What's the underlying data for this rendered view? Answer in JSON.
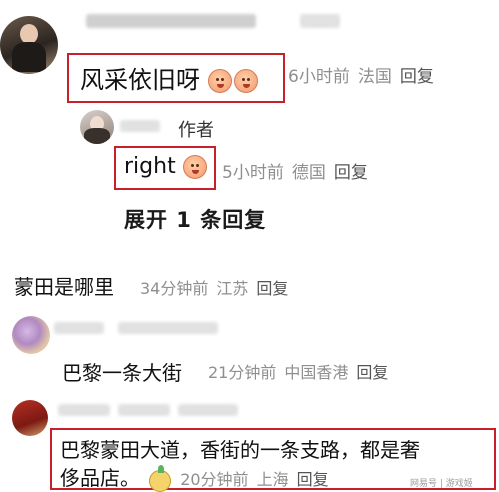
{
  "comments": [
    {
      "text": "风采依旧呀",
      "time": "6小时前",
      "location": "法国",
      "reply": "回复",
      "reply_thread": {
        "author_tag": "作者",
        "text": "right",
        "time": "5小时前",
        "location": "德国",
        "reply": "回复",
        "expand": "展开 1 条回复"
      }
    },
    {
      "text": "蒙田是哪里",
      "time": "34分钟前",
      "location": "江苏",
      "reply": "回复"
    },
    {
      "text": "巴黎一条大街",
      "time": "21分钟前",
      "location": "中国香港",
      "reply": "回复"
    },
    {
      "text_line1": "巴黎蒙田大道，香街的一条支路，都是奢",
      "text_line2": "侈品店。",
      "time": "20分钟前",
      "location": "上海",
      "reply": "回复"
    }
  ],
  "watermark": "网易号 | 游戏姬",
  "colors": {
    "highlight_border": "#c8202b",
    "meta_text": "#8f8f8f",
    "link_text": "#1a1a1a"
  }
}
